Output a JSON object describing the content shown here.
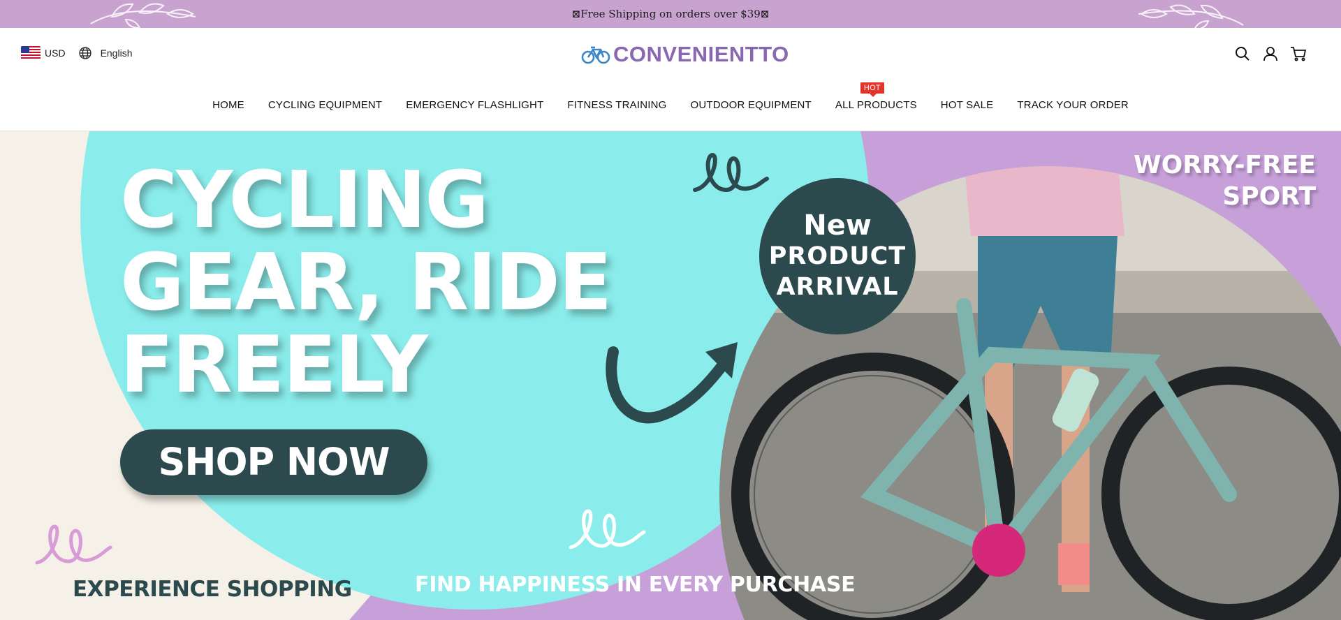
{
  "announcement": {
    "text": "⊠Free Shipping on orders over $39⊠"
  },
  "header": {
    "currency": "USD",
    "language": "English",
    "logo_text": "CONVENIENTTO",
    "icons": [
      "search-icon",
      "account-icon",
      "cart-icon"
    ]
  },
  "nav": {
    "items": [
      {
        "label": "HOME"
      },
      {
        "label": "CYCLING EQUIPMENT"
      },
      {
        "label": "EMERGENCY FLASHLIGHT"
      },
      {
        "label": "FITNESS TRAINING"
      },
      {
        "label": "OUTDOOR EQUIPMENT"
      },
      {
        "label": "ALL PRODUCTS",
        "badge": "HOT"
      },
      {
        "label": "HOT SALE"
      },
      {
        "label": "TRACK YOUR ORDER"
      }
    ]
  },
  "hero": {
    "headline": [
      "CYCLING",
      "GEAR, RIDE",
      "FREELY"
    ],
    "button_label": "SHOP NOW",
    "badge": [
      "New",
      "PRODUCT",
      "ARRIVAL"
    ],
    "tagline": [
      "WORRY-FREE",
      "SPORT"
    ],
    "bottom_left": "EXPERIENCE SHOPPING",
    "bottom_center": "FIND HAPPINESS IN EVERY PURCHASE"
  },
  "colors": {
    "announcement_bg": "#c9a3cf",
    "brand_purple": "#8a67b2",
    "hero_cyan": "#8aedeb",
    "hero_purple": "#c7a0da",
    "hero_dark_teal": "#2c4a4e",
    "hot_badge": "#e2342a"
  }
}
